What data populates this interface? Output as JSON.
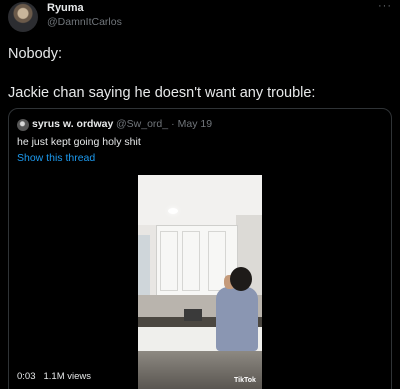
{
  "tweet": {
    "display_name": "Ryuma",
    "handle": "@DamnItCarlos",
    "more_icon": "···",
    "text_line1": "Nobody:",
    "text_line2": "Jackie chan saying he doesn't want any trouble:"
  },
  "quoted_tweet": {
    "display_name": "syrus w. ordway",
    "handle": "@Sw_ord_",
    "separator": "·",
    "date": "May 19",
    "text": "he just kept going holy shit",
    "show_thread_label": "Show this thread",
    "video": {
      "duration": "0:03",
      "views": "1.1M views",
      "watermark": "TikTok"
    }
  },
  "colors": {
    "background": "#000000",
    "text": "#e7e9ea",
    "secondary": "#71767b",
    "link": "#1d9bf0",
    "border": "#2f3336"
  }
}
